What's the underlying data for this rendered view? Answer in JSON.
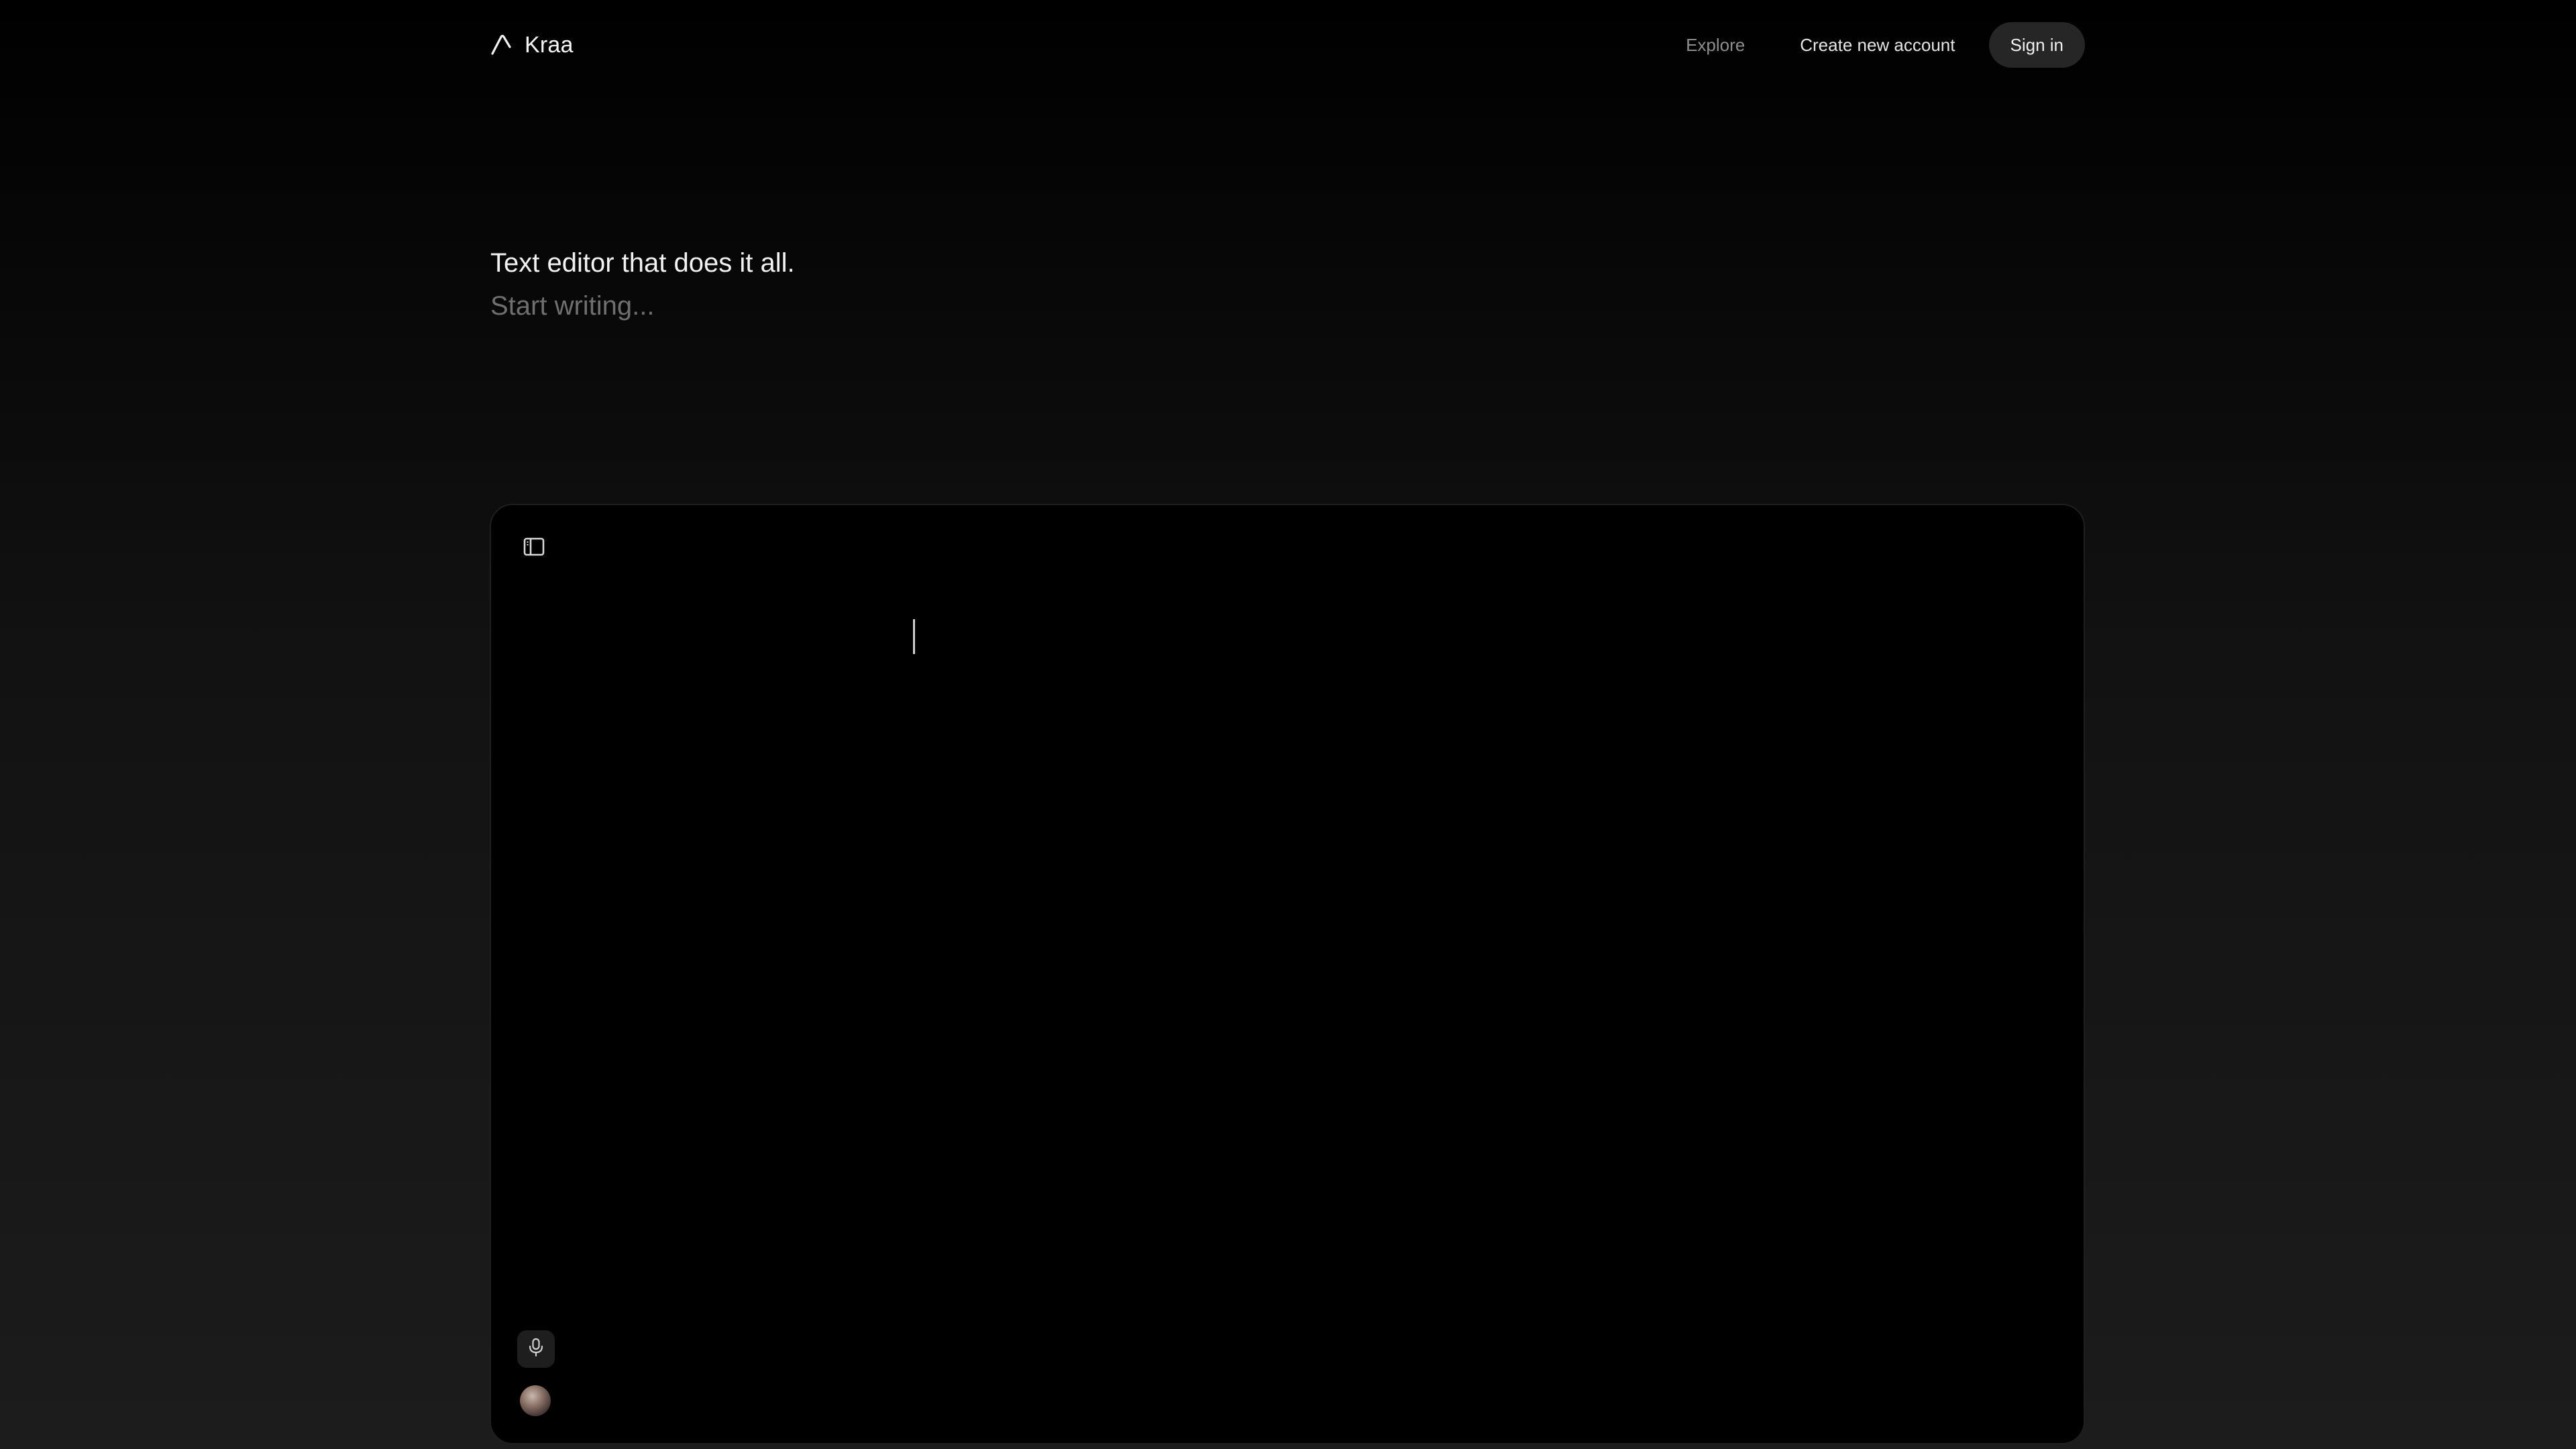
{
  "header": {
    "brand_name": "Kraa",
    "nav": {
      "explore_label": "Explore",
      "create_account_label": "Create new account",
      "sign_in_label": "Sign in"
    }
  },
  "hero": {
    "title": "Text editor that does it all.",
    "placeholder": "Start writing..."
  },
  "editor": {
    "icons": {
      "sidebar_toggle": "sidebar-toggle-icon",
      "microphone": "microphone-icon",
      "avatar": "user-avatar"
    }
  },
  "colors": {
    "background_top": "#000000",
    "background_bottom": "#1c1c1c",
    "editor_background": "#000000",
    "sign_in_button": "#262626",
    "text_primary": "#f2f2f2",
    "text_muted": "#6f6f6f"
  }
}
